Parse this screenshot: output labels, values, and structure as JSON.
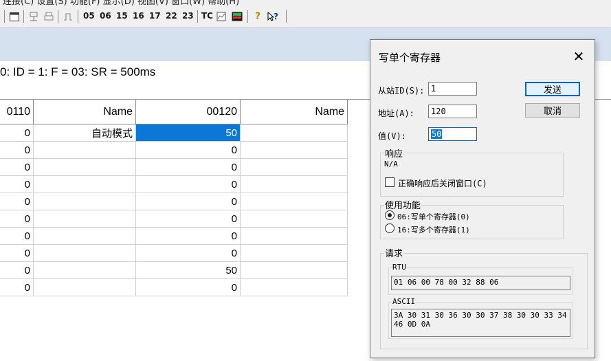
{
  "menubar": {
    "text": "连接(C)  设置(S)  功能(F)  显示(D)  视图(V)  窗口(W)  帮助(H)"
  },
  "toolbar": {
    "function_codes": [
      "05",
      "06",
      "15",
      "16",
      "17",
      "22",
      "23"
    ],
    "tc_label": "TC",
    "help_glyph": "?",
    "context_help_glyph": "?"
  },
  "status": {
    "text": "0: ID = 1: F = 03: SR = 500ms"
  },
  "grid": {
    "headers": [
      "0110",
      "Name",
      "00120",
      "Name"
    ],
    "rows": [
      {
        "c0": "0",
        "name1": "自动模式",
        "c2": "50"
      },
      {
        "c0": "0",
        "name1": "",
        "c2": "0"
      },
      {
        "c0": "0",
        "name1": "",
        "c2": "0"
      },
      {
        "c0": "0",
        "name1": "",
        "c2": "0"
      },
      {
        "c0": "0",
        "name1": "",
        "c2": "0"
      },
      {
        "c0": "0",
        "name1": "",
        "c2": "0"
      },
      {
        "c0": "0",
        "name1": "",
        "c2": "0"
      },
      {
        "c0": "0",
        "name1": "",
        "c2": "0"
      },
      {
        "c0": "0",
        "name1": "",
        "c2": "50"
      },
      {
        "c0": "0",
        "name1": "",
        "c2": "0"
      }
    ]
  },
  "dialog": {
    "title": "写单个寄存器",
    "close_glyph": "✕",
    "slave_id_label": "从站ID(S):",
    "slave_id_value": "1",
    "address_label": "地址(A):",
    "address_value": "120",
    "value_label": "值(V):",
    "value_value": "50",
    "send_button": "发送",
    "cancel_button": "取消",
    "response_group": "响应",
    "response_text": "N/A",
    "close_on_response_label": "正确响应后关闭窗口(C)",
    "function_group": "使用功能",
    "option_06": "06:写单个寄存器(0)",
    "option_16": "16:写多个寄存器(1)",
    "request_group": "请求",
    "rtu_label": "RTU",
    "rtu_value": "01 06 00 78 00 32 88 06",
    "ascii_label": "ASCII",
    "ascii_value": "3A 30 31 30 36 30 30 37 38 30 30 33 34 46 0D 0A"
  },
  "colors": {
    "selection": "#0b78d7",
    "band": "#d6e1ef",
    "dialog_bg": "#f0f0f0"
  }
}
